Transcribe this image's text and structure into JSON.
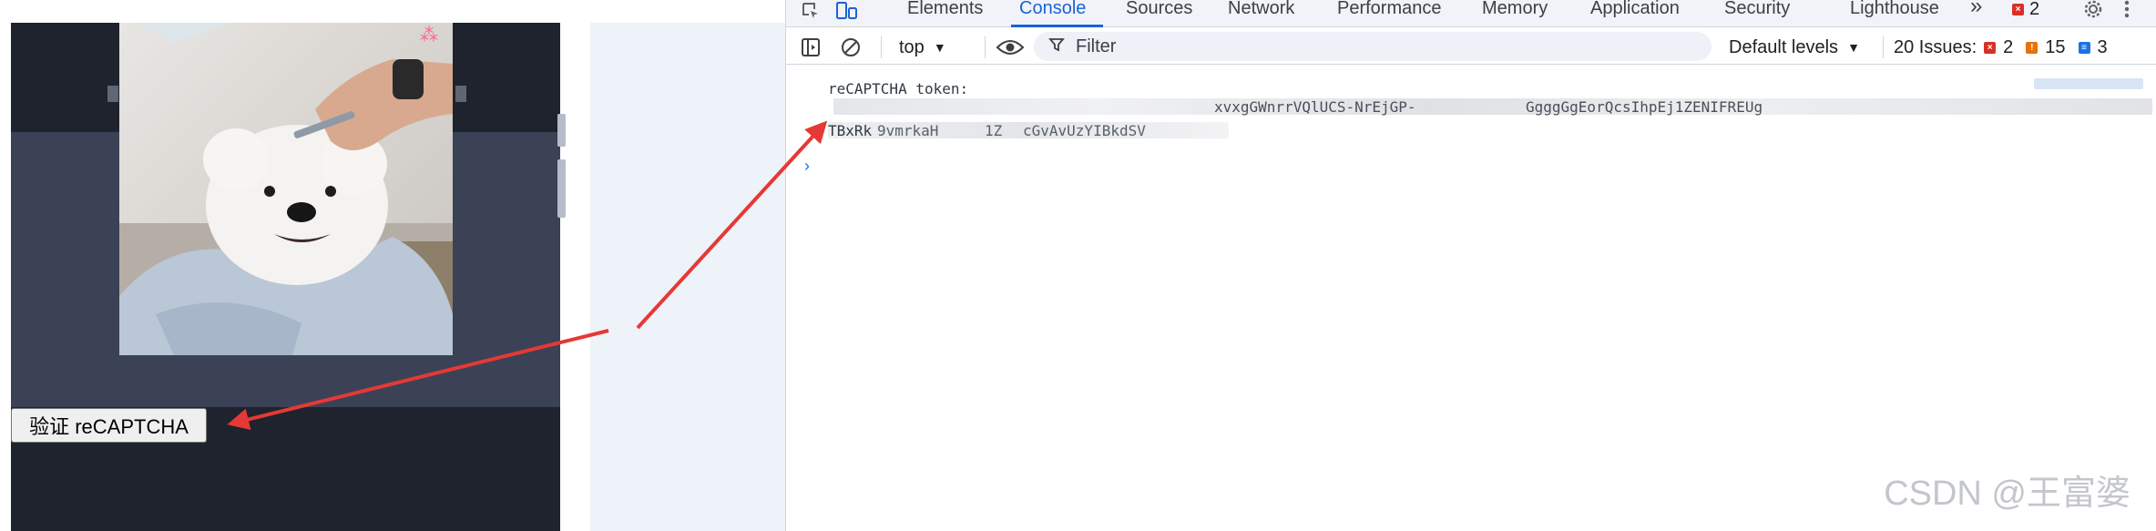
{
  "page": {
    "verify_button_label": "验证 reCAPTCHA"
  },
  "devtools": {
    "tabs": [
      {
        "label": "Elements"
      },
      {
        "label": "Console",
        "active": true
      },
      {
        "label": "Sources"
      },
      {
        "label": "Network"
      },
      {
        "label": "Performance"
      },
      {
        "label": "Memory"
      },
      {
        "label": "Application"
      },
      {
        "label": "Security"
      },
      {
        "label": "Lighthouse"
      }
    ],
    "more_tabs": "»",
    "error_count": "2",
    "toolbar": {
      "context": "top",
      "filter_placeholder": "Filter",
      "levels": "Default levels",
      "issues_label": "20 Issues:",
      "issues_errors": "2",
      "issues_warnings": "15",
      "issues_info": "3"
    },
    "console": {
      "log_label": "reCAPTCHA token:",
      "token_line1_part1": "xvxgGWnrrVQlUCS-NrEjGP-",
      "token_line1_part2": "GgggGgEorQcsIhpEj1ZENIFREUg",
      "token_line2_start": "TBxRk",
      "token_line2_part1": "9vmrkaH",
      "token_line2_part2": "1Z",
      "token_line2_part3": "cGvAvUzYIBkdSV"
    }
  },
  "colors": {
    "accent": "#1a62d6",
    "error": "#d93025",
    "warning": "#e8710a",
    "info": "#1a73e8",
    "arrow": "#e53935"
  },
  "watermark": "CSDN @王富婆"
}
